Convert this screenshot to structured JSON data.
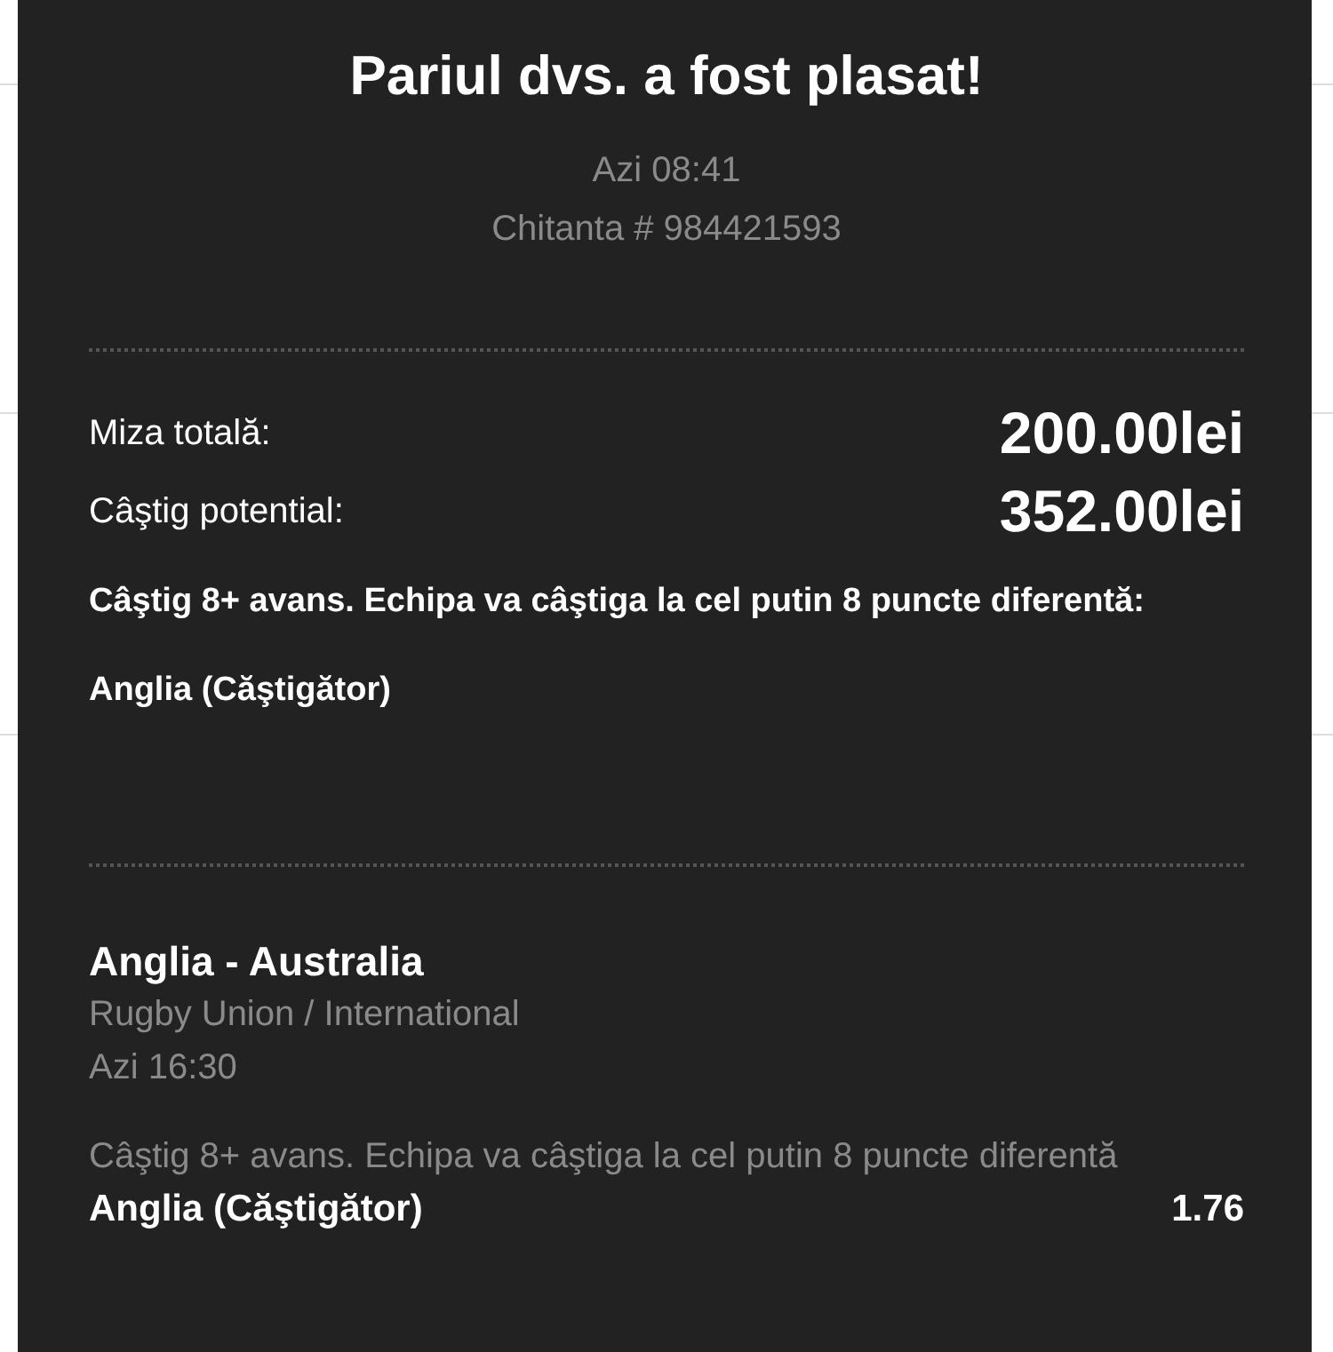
{
  "dialog": {
    "title": "Pariul dvs. a fost plasat!",
    "time": "Azi 08:41",
    "receipt": "Chitanta # 984421593"
  },
  "summary": [
    {
      "label": "Miza totală:",
      "value": "200.00lei"
    },
    {
      "label": "Câştig potential:",
      "value": "352.00lei"
    }
  ],
  "selection_summary": "Câştig 8+ avans. Echipa va câştiga la cel putin 8 puncte diferentă: Anglia (Căştigător)",
  "bets": [
    {
      "event": "Anglia - Australia",
      "competition": "Rugby Union / International",
      "start": "Azi 16:30",
      "market": "Câştig 8+ avans. Echipa va câştiga la cel putin 8 puncte diferentă",
      "selection": "Anglia (Căştigător)",
      "odds": "1.76"
    }
  ]
}
